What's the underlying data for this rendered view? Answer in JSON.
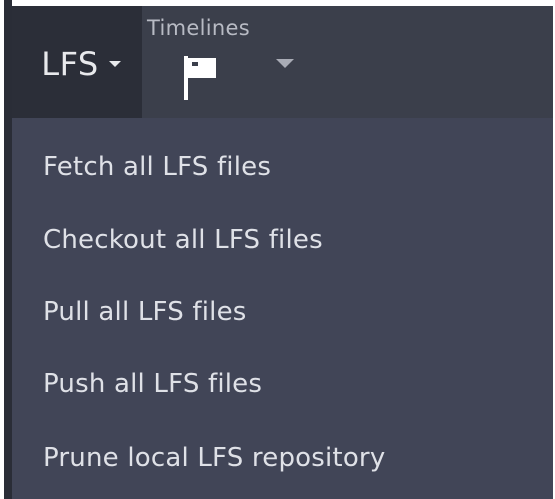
{
  "toolbar": {
    "lfs_label": "LFS",
    "timelines_label": "Timelines"
  },
  "icons": {
    "lfs_caret": "caret-down-icon",
    "timelines_flag": "flag-icon",
    "timelines_caret": "caret-down-icon"
  },
  "menu": {
    "items": [
      {
        "label": "Fetch all LFS files"
      },
      {
        "label": "Checkout all LFS files"
      },
      {
        "label": "Pull all LFS files"
      },
      {
        "label": "Push all LFS files"
      },
      {
        "label": "Prune local LFS repository"
      }
    ]
  },
  "colors": {
    "toolbar_bg": "#3b3f4b",
    "active_button_bg": "#2b2e38",
    "menu_bg": "#414557",
    "menu_text": "#dfe1e7",
    "secondary_text": "#b8bbc4"
  }
}
